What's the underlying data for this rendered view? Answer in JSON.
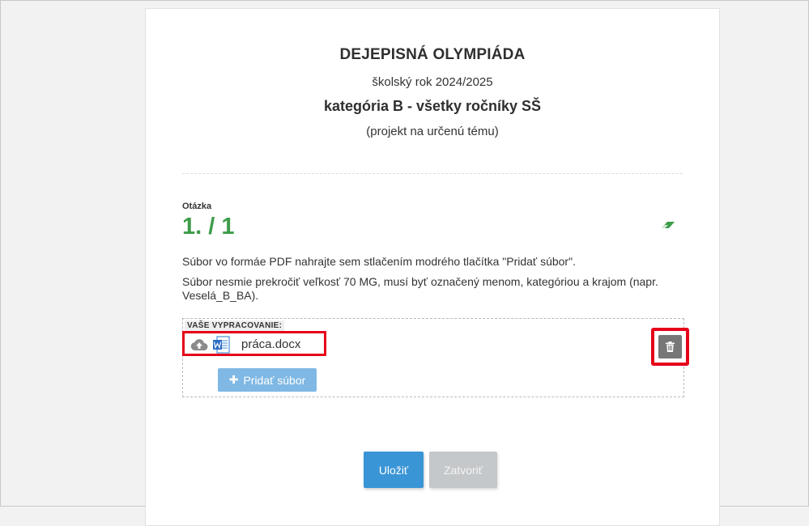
{
  "header": {
    "title": "DEJEPISNÁ OLYMPIÁDA",
    "school_year": "školský rok 2024/2025",
    "category": "kategória B - všetky ročníky SŠ",
    "subtitle": "(projekt na určenú tému)"
  },
  "question": {
    "label": "Otázka",
    "number": "1. / 1",
    "instruction_1": "Súbor vo formáe PDF nahrajte sem stlačením modrého tlačítka \"Pridať súbor\".",
    "instruction_2": "Súbor nesmie prekročiť veľkosť 70 MG, musí byť označený menom, kategóriou a krajom (napr. Veselá_B_BA).",
    "eraser_icon": "eraser-icon",
    "number_color": "#3d9c4a"
  },
  "answer": {
    "label": "VAŠE VYPRACOVANIE:",
    "file_name": "práca.docx",
    "file_icons": [
      "cloud-upload-icon",
      "word-document-icon"
    ],
    "delete_icon": "trash-icon",
    "add_file_label": "Pridať súbor",
    "highlight_color": "#e6001a"
  },
  "footer": {
    "save_label": "Uložiť",
    "close_label": "Zatvoriť",
    "save_color": "#3a95d6",
    "close_color": "#c5c8ca"
  }
}
